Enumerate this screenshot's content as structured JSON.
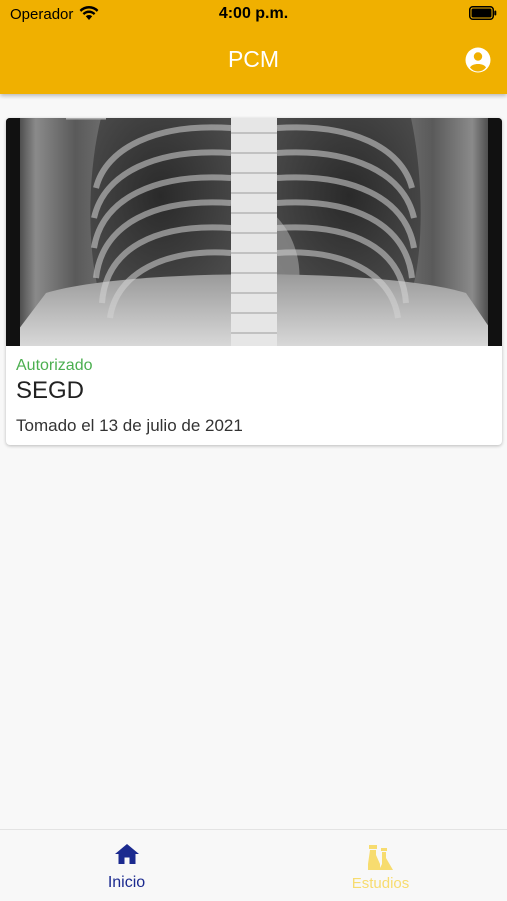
{
  "status_bar": {
    "carrier": "Operador",
    "time": "4:00 p.m."
  },
  "header": {
    "title": "PCM",
    "account_icon": "account-circle-icon"
  },
  "study_card": {
    "image": "chest-xray",
    "status": "Autorizado",
    "name": "SEGD",
    "date": "Tomado el 13 de julio de 2021"
  },
  "bottom_nav": {
    "items": [
      {
        "label": "Inicio",
        "icon": "home-icon",
        "active": true
      },
      {
        "label": "Estudios",
        "icon": "lab-flask-icon",
        "active": false
      }
    ]
  },
  "colors": {
    "accent": "#f0b000",
    "status_authorized": "#4caf50",
    "nav_active": "#1b2a8f",
    "nav_inactive": "#f7dc6f"
  }
}
